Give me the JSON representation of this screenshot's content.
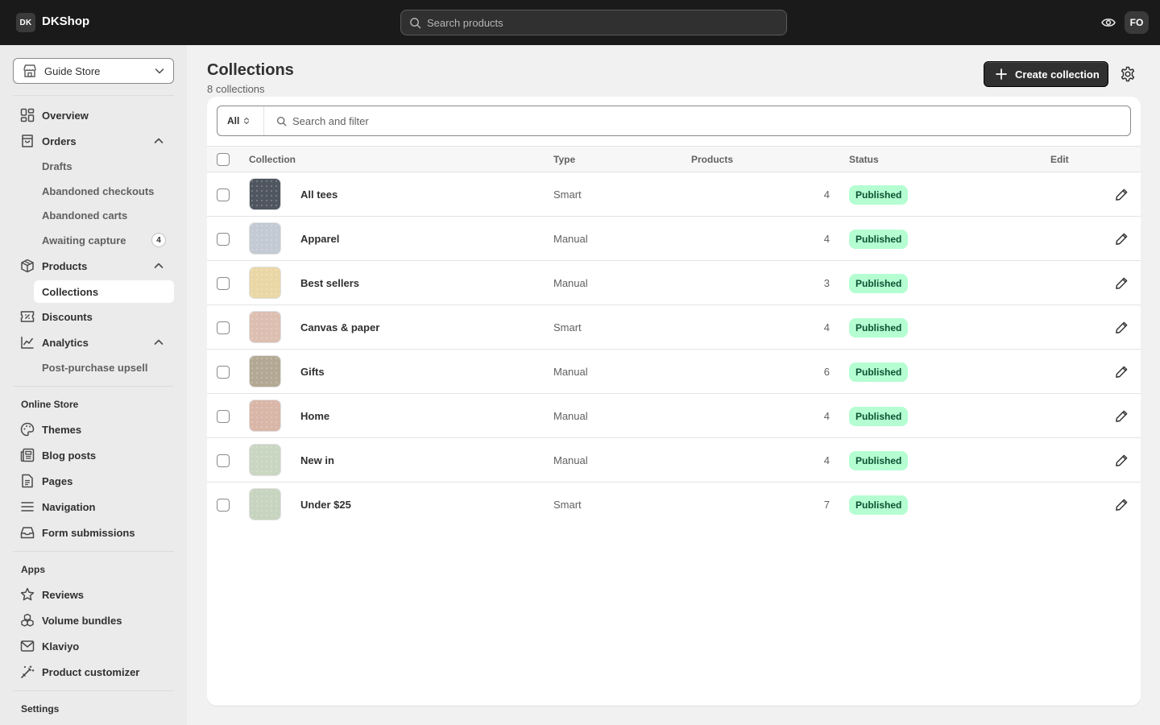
{
  "topbar": {
    "logo_badge": "DK",
    "shop_name": "DKShop",
    "search_placeholder": "Search products",
    "avatar_initials": "FO"
  },
  "sidebar": {
    "store_name": "Guide Store",
    "nav": {
      "overview": "Overview",
      "orders": "Orders",
      "drafts": "Drafts",
      "abandoned_checkouts": "Abandoned checkouts",
      "abandoned_carts": "Abandoned carts",
      "awaiting_capture": "Awaiting capture",
      "awaiting_capture_count": "4",
      "products": "Products",
      "collections": "Collections",
      "discounts": "Discounts",
      "analytics": "Analytics",
      "post_purchase_upsell": "Post-purchase upsell"
    },
    "online_store": {
      "title": "Online Store",
      "themes": "Themes",
      "blog_posts": "Blog posts",
      "pages": "Pages",
      "navigation": "Navigation",
      "form_submissions": "Form submissions"
    },
    "apps": {
      "title": "Apps",
      "reviews": "Reviews",
      "volume_bundles": "Volume bundles",
      "klaviyo": "Klaviyo",
      "product_customizer": "Product customizer"
    },
    "settings_title": "Settings"
  },
  "page": {
    "title": "Collections",
    "subtitle": "8 collections",
    "create_button": "Create collection"
  },
  "filter": {
    "view": "All",
    "search_placeholder": "Search and filter"
  },
  "table": {
    "headers": {
      "collection": "Collection",
      "type": "Type",
      "products": "Products",
      "status": "Status",
      "edit": "Edit"
    },
    "rows": [
      {
        "name": "All tees",
        "type": "Smart",
        "products": "4",
        "status": "Published",
        "thumb_color": "#4f5660"
      },
      {
        "name": "Apparel",
        "type": "Manual",
        "products": "4",
        "status": "Published",
        "thumb_color": "#c3cad3"
      },
      {
        "name": "Best sellers",
        "type": "Manual",
        "products": "3",
        "status": "Published",
        "thumb_color": "#ead7a6"
      },
      {
        "name": "Canvas & paper",
        "type": "Smart",
        "products": "4",
        "status": "Published",
        "thumb_color": "#ddbfb1"
      },
      {
        "name": "Gifts",
        "type": "Manual",
        "products": "6",
        "status": "Published",
        "thumb_color": "#b3a893"
      },
      {
        "name": "Home",
        "type": "Manual",
        "products": "4",
        "status": "Published",
        "thumb_color": "#d9b6a7"
      },
      {
        "name": "New in",
        "type": "Manual",
        "products": "4",
        "status": "Published",
        "thumb_color": "#c9d6c1"
      },
      {
        "name": "Under $25",
        "type": "Smart",
        "products": "7",
        "status": "Published",
        "thumb_color": "#c7d4bf"
      }
    ]
  },
  "colors": {
    "topbar_bg": "#1a1a1a",
    "status_published_bg": "#b4fed2",
    "status_published_text": "#0c5132",
    "primary_button": "#303030"
  }
}
